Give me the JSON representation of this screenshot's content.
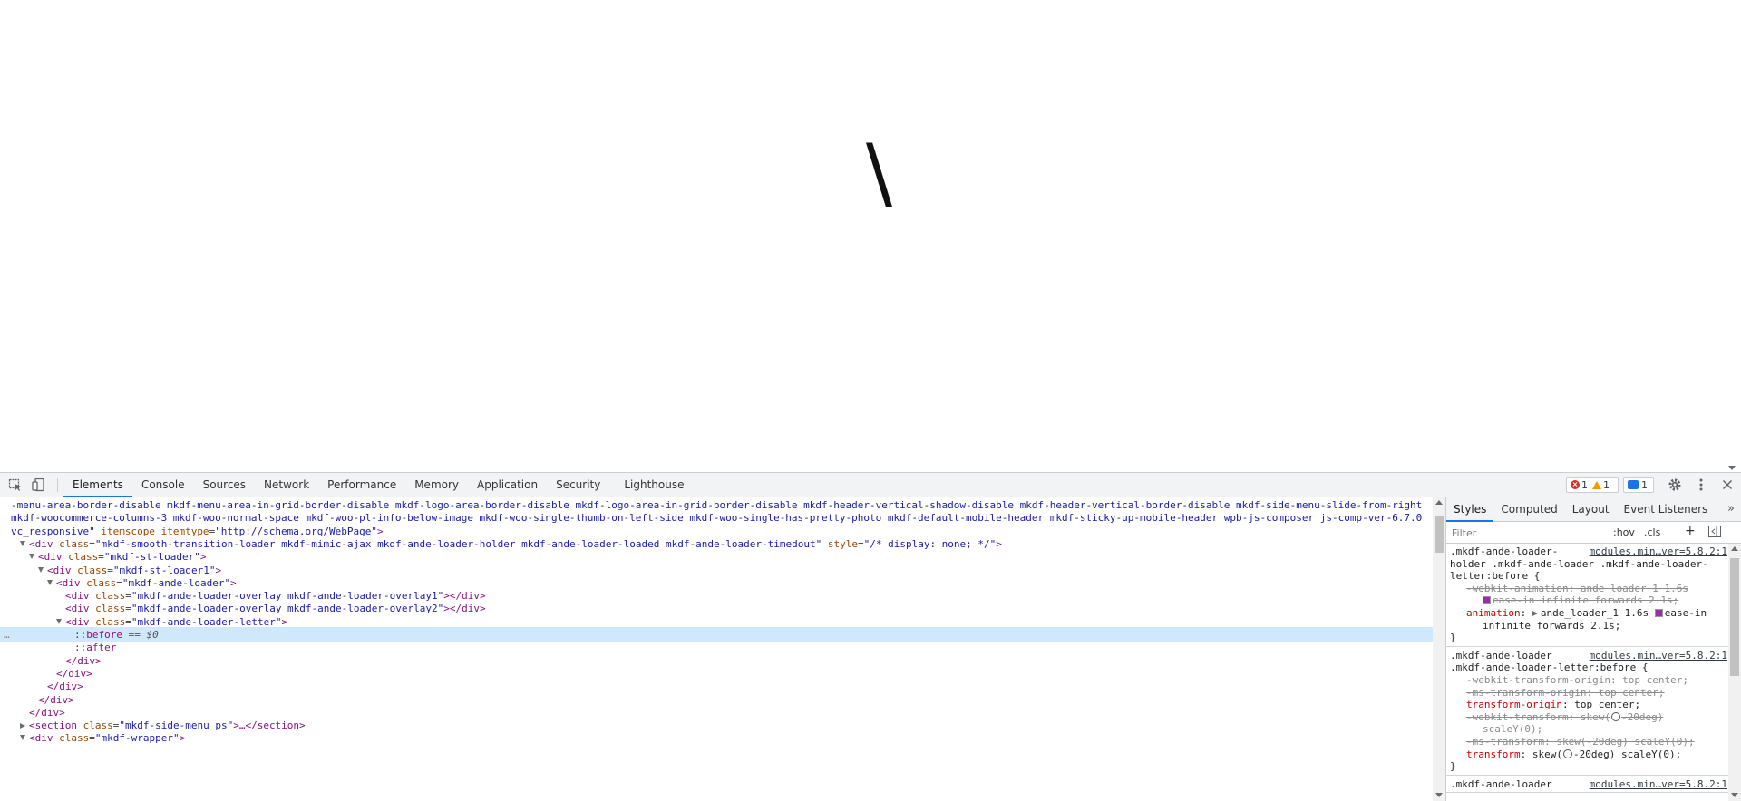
{
  "page": {
    "loader_letter": "\\"
  },
  "devtools": {
    "tabs": [
      "Elements",
      "Console",
      "Sources",
      "Network",
      "Performance",
      "Memory",
      "Application",
      "Security",
      "Lighthouse"
    ],
    "errors": "1",
    "warnings": "1",
    "messages": "1",
    "icons": {
      "inspect": "inspect-element-icon",
      "device": "device-toolbar-icon",
      "settings": "gear-icon",
      "more": "more-vertical-icon",
      "close": "close-icon"
    },
    "colors": {
      "active_tab_underline": "#1a73e8",
      "selected_row": "#cfe8fc",
      "tag": "#881280",
      "attr_name": "#994500",
      "attr_value": "#1a1aa6",
      "css_property": "#c80000",
      "error": "#d93025",
      "warning": "#f29900"
    }
  },
  "elements": {
    "lines": [
      {
        "indent": 12,
        "text": "-menu-area-border-disable mkdf-menu-area-in-grid-border-disable mkdf-logo-area-border-disable mkdf-logo-area-in-grid-border-disable mkdf-header-vertical-shadow-disable mkdf-header-vertical-border-disable mkdf-side-menu-slide-from-right",
        "kind": "attr-cont"
      },
      {
        "indent": 12,
        "text": "mkdf-woocommerce-columns-3 mkdf-woo-normal-space mkdf-woo-pl-info-below-image mkdf-woo-single-thumb-on-left-side mkdf-woo-single-has-pretty-photo mkdf-default-mobile-header mkdf-sticky-up-mobile-header wpb-js-composer js-comp-ver-6.7.0",
        "kind": "attr-cont"
      },
      {
        "indent": 12,
        "text": "vc_responsive\"",
        "kind": "attr-end",
        "rest_attr1": "itemscope",
        "rest_attr2": "itemtype",
        "rest_val2": "\"http://schema.org/WebPage\"",
        "close": ">"
      },
      {
        "indent": 22,
        "toggle": "open",
        "tag": "div",
        "attr": "class",
        "val": "\"mkdf-smooth-transition-loader mkdf-mimic-ajax mkdf-ande-loader-holder mkdf-ande-loader-loaded mkdf-ande-loader-timedout\"",
        "attr2": "style",
        "val2": "\"/* display: none; */\"",
        "close": ">"
      },
      {
        "indent": 32,
        "toggle": "open",
        "tag": "div",
        "attr": "class",
        "val": "\"mkdf-st-loader\"",
        "close": ">"
      },
      {
        "indent": 42,
        "toggle": "open",
        "tag": "div",
        "attr": "class",
        "val": "\"mkdf-st-loader1\"",
        "close": ">"
      },
      {
        "indent": 52,
        "toggle": "open",
        "tag": "div",
        "attr": "class",
        "val": "\"mkdf-ande-loader\"",
        "close": ">"
      },
      {
        "indent": 72,
        "tag": "div",
        "attr": "class",
        "val": "\"mkdf-ande-loader-overlay mkdf-ande-loader-overlay1\"",
        "close": "></div>"
      },
      {
        "indent": 72,
        "tag": "div",
        "attr": "class",
        "val": "\"mkdf-ande-loader-overlay mkdf-ande-loader-overlay2\"",
        "close": "></div>"
      },
      {
        "indent": 62,
        "toggle": "open",
        "tag": "div",
        "attr": "class",
        "val": "\"mkdf-ande-loader-letter\"",
        "close": ">"
      },
      {
        "indent": 82,
        "pseudo": "::before",
        "eq": " == $0",
        "selected": true
      },
      {
        "indent": 82,
        "pseudo": "::after"
      },
      {
        "indent": 72,
        "closetag": "</div>"
      },
      {
        "indent": 62,
        "closetag": "</div>"
      },
      {
        "indent": 52,
        "closetag": "</div>"
      },
      {
        "indent": 42,
        "closetag": "</div>"
      },
      {
        "indent": 32,
        "closetag": "</div>"
      },
      {
        "indent": 22,
        "toggle": "closed",
        "tag": "section",
        "attr": "class",
        "val": "\"mkdf-side-menu ps\"",
        "close": ">…</section>"
      },
      {
        "indent": 22,
        "toggle": "open",
        "tag": "div",
        "attr": "class",
        "val": "\"mkdf-wrapper\"",
        "close": ">"
      }
    ],
    "selected_marker": "…"
  },
  "styles": {
    "tabs": [
      "Styles",
      "Computed",
      "Layout",
      "Event Listeners"
    ],
    "more": "»",
    "filter_placeholder": "Filter",
    "hov": ":hov",
    "cls": ".cls",
    "add": "+",
    "rules": [
      {
        "selector_lines": [
          ".mkdf-ande-loader-",
          "holder .mkdf-ande-loader .mkdf-ande-loader-",
          "letter:before {"
        ],
        "source": "modules.min…ver=5.8.2:1",
        "decls": [
          {
            "text": "-webkit-animation: ande_loader_1 1.6s",
            "struck": true
          },
          {
            "text": "ease-in infinite forwards 2.1s;",
            "struck": true,
            "swatch": true,
            "cont": true
          },
          {
            "name": "animation",
            "value": "ande_loader_1 1.6s",
            "after_swatch": "ease-in",
            "tri": true
          },
          {
            "text": "infinite forwards 2.1s;",
            "cont": true
          }
        ],
        "close": "}"
      },
      {
        "selector_lines": [
          ".mkdf-ande-loader",
          ".mkdf-ande-loader-letter:before {"
        ],
        "source": "modules.min…ver=5.8.2:1",
        "decls": [
          {
            "text": "-webkit-transform-origin: top center;",
            "struck": true
          },
          {
            "text": "-ms-transform-origin: top center;",
            "struck": true
          },
          {
            "name": "transform-origin",
            "value": "top center;"
          },
          {
            "text": "-webkit-transform: skew(",
            "text2": "-20deg)",
            "struck": true,
            "clock": true
          },
          {
            "text": "scaleY(0);",
            "struck": true,
            "cont": true
          },
          {
            "text": "-ms-transform: skew(-20deg) scaleY(0);",
            "struck": true
          },
          {
            "name": "transform",
            "value": "skew(",
            "value2": "-20deg) scaleY(0);",
            "clock": true
          }
        ],
        "close": "}"
      },
      {
        "selector_lines": [
          ".mkdf-ande-loader"
        ],
        "source": "modules.min…ver=5.8.2:1",
        "decls": [],
        "close": ""
      }
    ]
  }
}
